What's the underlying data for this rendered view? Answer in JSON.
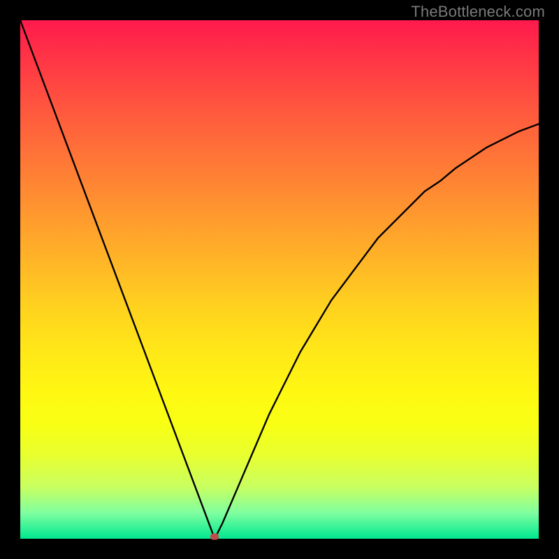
{
  "watermark": "TheBottleneck.com",
  "chart_data": {
    "type": "line",
    "title": "",
    "xlabel": "",
    "ylabel": "",
    "xlim": [
      0,
      100
    ],
    "ylim": [
      0,
      100
    ],
    "grid": false,
    "legend": false,
    "background": {
      "gradient_top_color": "#ff1a4d",
      "gradient_bottom_color": "#00e890",
      "meaning": "red high / green low bottleneck"
    },
    "series": [
      {
        "name": "bottleneck-curve",
        "color": "#000000",
        "x": [
          0,
          3,
          6,
          9,
          12,
          15,
          18,
          21,
          24,
          27,
          30,
          33,
          36,
          37.5,
          39,
          42,
          45,
          48,
          51,
          54,
          57,
          60,
          63,
          66,
          69,
          72,
          75,
          78,
          81,
          84,
          87,
          90,
          93,
          96,
          100
        ],
        "values": [
          100,
          92,
          84,
          76,
          68,
          60,
          52,
          44,
          36,
          28,
          20,
          12,
          4,
          0,
          3,
          10,
          17,
          24,
          30,
          36,
          41,
          46,
          50,
          54,
          58,
          61,
          64,
          67,
          69,
          71.5,
          73.5,
          75.5,
          77,
          78.5,
          80
        ]
      }
    ],
    "marker": {
      "x": 37.5,
      "y": 0,
      "color": "#c24a4a"
    }
  }
}
